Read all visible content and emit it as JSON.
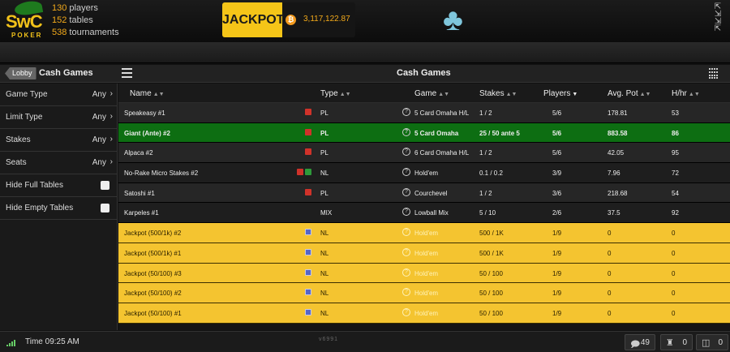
{
  "header": {
    "logo_text": "SwC",
    "logo_sub": "POKER",
    "stats": [
      {
        "num": "130",
        "label": "players"
      },
      {
        "num": "152",
        "label": "tables"
      },
      {
        "num": "538",
        "label": "tournaments"
      }
    ],
    "jackpot_label": "JACKPOT",
    "jackpot_coin": "₿",
    "jackpot_amount": "3,117,122.87"
  },
  "panel": {
    "lobby_label": "Lobby",
    "left_title": "Cash Games",
    "main_title": "Cash Games"
  },
  "filters": [
    {
      "label": "Game Type",
      "value": "Any",
      "kind": "select"
    },
    {
      "label": "Limit Type",
      "value": "Any",
      "kind": "select"
    },
    {
      "label": "Stakes",
      "value": "Any",
      "kind": "select"
    },
    {
      "label": "Seats",
      "value": "Any",
      "kind": "select"
    },
    {
      "label": "Hide Full Tables",
      "value": "",
      "kind": "checkbox"
    },
    {
      "label": "Hide Empty Tables",
      "value": "",
      "kind": "checkbox"
    }
  ],
  "columns": [
    "Name",
    "Type",
    "Game",
    "Stakes",
    "Players",
    "Avg. Pot",
    "H/hr"
  ],
  "rows": [
    {
      "name": "Speakeasy #1",
      "badges": [
        "red"
      ],
      "type": "PL",
      "game": "5 Card Omaha H/L",
      "stakes": "1 / 2",
      "players": "5/6",
      "avg_pot": "178.81",
      "hhr": "53",
      "style": "dark1",
      "q": true
    },
    {
      "name": "Giant (Ante) #2",
      "badges": [
        "red"
      ],
      "type": "PL",
      "game": "5 Card Omaha",
      "stakes": "25 / 50 ante 5",
      "players": "5/6",
      "avg_pot": "883.58",
      "hhr": "86",
      "style": "green",
      "q": true
    },
    {
      "name": "Alpaca #2",
      "badges": [
        "red"
      ],
      "type": "PL",
      "game": "6 Card Omaha H/L",
      "stakes": "1 / 2",
      "players": "5/6",
      "avg_pot": "42.05",
      "hhr": "95",
      "style": "dark1",
      "q": true
    },
    {
      "name": "No-Rake Micro Stakes #2",
      "badges": [
        "red",
        "grn"
      ],
      "type": "NL",
      "game": "Hold'em",
      "stakes": "0.1 / 0.2",
      "players": "3/9",
      "avg_pot": "7.96",
      "hhr": "72",
      "style": "dark2",
      "q": true
    },
    {
      "name": "Satoshi #1",
      "badges": [
        "red"
      ],
      "type": "PL",
      "game": "Courchevel",
      "stakes": "1 / 2",
      "players": "3/6",
      "avg_pot": "218.68",
      "hhr": "54",
      "style": "dark1",
      "q": true
    },
    {
      "name": "Karpeles #1",
      "badges": [],
      "type": "MIX",
      "game": "Lowball Mix",
      "stakes": "5 / 10",
      "players": "2/6",
      "avg_pot": "37.5",
      "hhr": "92",
      "style": "dark2",
      "q": true
    },
    {
      "name": "Jackpot (500/1k) #2",
      "badges": [
        "blue"
      ],
      "type": "NL",
      "game": "Hold'em",
      "stakes": "500 / 1K",
      "players": "1/9",
      "avg_pot": "0",
      "hhr": "0",
      "style": "gold",
      "q": true
    },
    {
      "name": "Jackpot (500/1k) #1",
      "badges": [
        "blue"
      ],
      "type": "NL",
      "game": "Hold'em",
      "stakes": "500 / 1K",
      "players": "1/9",
      "avg_pot": "0",
      "hhr": "0",
      "style": "gold",
      "q": true
    },
    {
      "name": "Jackpot (50/100) #3",
      "badges": [
        "blue"
      ],
      "type": "NL",
      "game": "Hold'em",
      "stakes": "50 / 100",
      "players": "1/9",
      "avg_pot": "0",
      "hhr": "0",
      "style": "gold",
      "q": true
    },
    {
      "name": "Jackpot (50/100) #2",
      "badges": [
        "blue"
      ],
      "type": "NL",
      "game": "Hold'em",
      "stakes": "50 / 100",
      "players": "1/9",
      "avg_pot": "0",
      "hhr": "0",
      "style": "gold",
      "q": true
    },
    {
      "name": "Jackpot (50/100) #1",
      "badges": [
        "blue"
      ],
      "type": "NL",
      "game": "Hold'em",
      "stakes": "50 / 100",
      "players": "1/9",
      "avg_pot": "0",
      "hhr": "0",
      "style": "gold",
      "q": true
    }
  ],
  "status": {
    "time_label": "Time 09:25 AM",
    "version": "v6991",
    "chat_count": "49",
    "table_count": "0",
    "toggle_count": "0"
  },
  "colors": {
    "accent_gold": "#f4c430",
    "highlight_green": "#0d6e12",
    "club": "#7fc6dc"
  }
}
